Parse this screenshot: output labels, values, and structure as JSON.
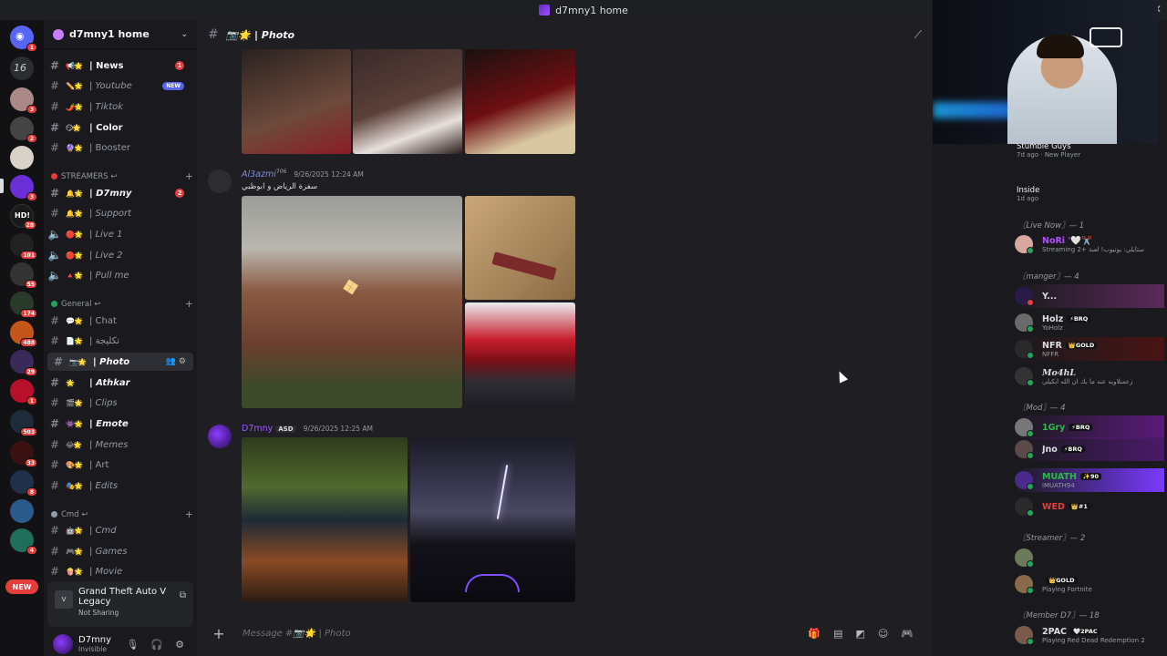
{
  "window": {
    "title": "d7mny1 home"
  },
  "rail": {
    "badges": [
      "1",
      "3",
      "2",
      "3",
      "28",
      "101",
      "55",
      "174",
      "488",
      "29",
      "1",
      "503",
      "33",
      "8",
      "4"
    ],
    "new_label": "NEW"
  },
  "guild": {
    "name": "d7mny1 home",
    "channels_top": [
      {
        "emoji": "📢🌟",
        "label": "| News",
        "badge": "1",
        "unread": true
      },
      {
        "emoji": "✏️🌟",
        "label": "| Youtube",
        "new": "NEW"
      },
      {
        "emoji": "🌶️🌟",
        "label": "| Tiktok"
      },
      {
        "emoji": "😏🌟",
        "label": "| Color",
        "unread": true
      },
      {
        "emoji": "🔮🌟",
        "label": "| Booster"
      }
    ],
    "cat_streamers": "STREAMERS ↩",
    "channels_streamers": [
      {
        "emoji": "🔔🌟",
        "label": "| D7mny",
        "badge": "2",
        "unread": true
      },
      {
        "emoji": "🔔🌟",
        "label": "| Support"
      },
      {
        "emoji": "🔴🌟",
        "label": "| Live 1"
      },
      {
        "emoji": "🔴🌟",
        "label": "| Live 2"
      },
      {
        "emoji": "🔺🌟",
        "label": "| Pull me"
      }
    ],
    "cat_general": "General ↩",
    "channels_general": [
      {
        "emoji": "💬🌟",
        "label": "| Chat"
      },
      {
        "emoji": "📄🌟",
        "label": "| تكليجة"
      },
      {
        "emoji": "📷🌟",
        "label": "| Photo",
        "active": true
      },
      {
        "emoji": "🌟",
        "label": "| Athkar",
        "unread": true
      },
      {
        "emoji": "🎬🌟",
        "label": "| Clips"
      },
      {
        "emoji": "👾🌟",
        "label": "| Emote",
        "unread": true
      },
      {
        "emoji": "😂🌟",
        "label": "| Memes"
      },
      {
        "emoji": "🎨🌟",
        "label": "| Art"
      },
      {
        "emoji": "🎭🌟",
        "label": "| Edits"
      }
    ],
    "cat_cmd": "Cmd ↩",
    "channels_cmd": [
      {
        "emoji": "🤖🌟",
        "label": "| Cmd"
      },
      {
        "emoji": "🎮🌟",
        "label": "| Games"
      },
      {
        "emoji": "🍿🌟",
        "label": "| Movie"
      }
    ]
  },
  "activity": {
    "game": "Grand Theft Auto V Legacy",
    "status": "Not Sharing"
  },
  "user": {
    "name": "D7mny",
    "status": "Invisible"
  },
  "channel_header": {
    "title": "📷🌟 | Photo"
  },
  "messages": [
    {
      "author": "Al3azmi",
      "author_sup": "706",
      "time": "9/26/2025 12:24 AM",
      "text": "سفرة الرياض و ابوظبي"
    },
    {
      "author": "D7mny",
      "tag": "ASD",
      "time": "9/26/2025 12:25 AM"
    }
  ],
  "composer": {
    "placeholder": "Message #📷🌟 | Photo"
  },
  "members": {
    "top_activities": [
      {
        "name": "Stumble Guys",
        "sub": "7d ago · New Player"
      },
      {
        "name": "Inside",
        "sub": "1d ago"
      }
    ],
    "groups": [
      {
        "title": "〖Live Now〗— 1",
        "members": [
          {
            "name": "NoRi '🤍✂️",
            "sub": "Streaming ستايلي: يوتيوب! لعبة +2",
            "color": "#b44dff"
          }
        ]
      },
      {
        "title": "〖manger〗— 4",
        "members": [
          {
            "name": "Y...",
            "sub": "",
            "color": "#f2f3f5"
          },
          {
            "name": "Holz",
            "tag": "⚡BRQ",
            "sub": "YoHolz",
            "color": "#f2f3f5"
          },
          {
            "name": "NFR",
            "tag": "👑GOLD",
            "sub": "NFFR",
            "color": "#f2f3f5"
          },
          {
            "name": "Mo4hL",
            "sub": "زعمتلاويه عنه ما بك ان الله ابكيلي",
            "color": "#f2f3f5"
          }
        ]
      },
      {
        "title": "〖Mod〗— 4",
        "members": [
          {
            "name": "1Gry",
            "tag": "⚡BRQ",
            "sub": "",
            "color": "#2fb84a"
          },
          {
            "name": "Jno",
            "tag": "⚡BRQ",
            "sub": "",
            "color": "#f2f3f5"
          },
          {
            "name": "MUATH",
            "tag": "✨90",
            "sub": "iMUATH94",
            "color": "#2fb84a"
          },
          {
            "name": "WED",
            "tag": "👑#1",
            "sub": "",
            "color": "#e53c3c"
          }
        ]
      },
      {
        "title": "〖Streamer〗— 2",
        "members": [
          {
            "name": "",
            "sub": "",
            "color": "#7b2ecf"
          },
          {
            "name": "",
            "tag": "👑GOLD",
            "sub": "Playing Fortnite",
            "color": "#7b2ecf"
          }
        ]
      },
      {
        "title": "〖Member D7〗— 18",
        "members": [
          {
            "name": "2PAC",
            "tag": "🤍2PAC",
            "sub": "Playing Red Dead Redemption 2",
            "color": "#f2f3f5"
          }
        ]
      }
    ]
  },
  "colors": {
    "accent": "#5865f2",
    "danger": "#e53c3c",
    "online": "#23a55a",
    "bg": "#1f1f23"
  }
}
